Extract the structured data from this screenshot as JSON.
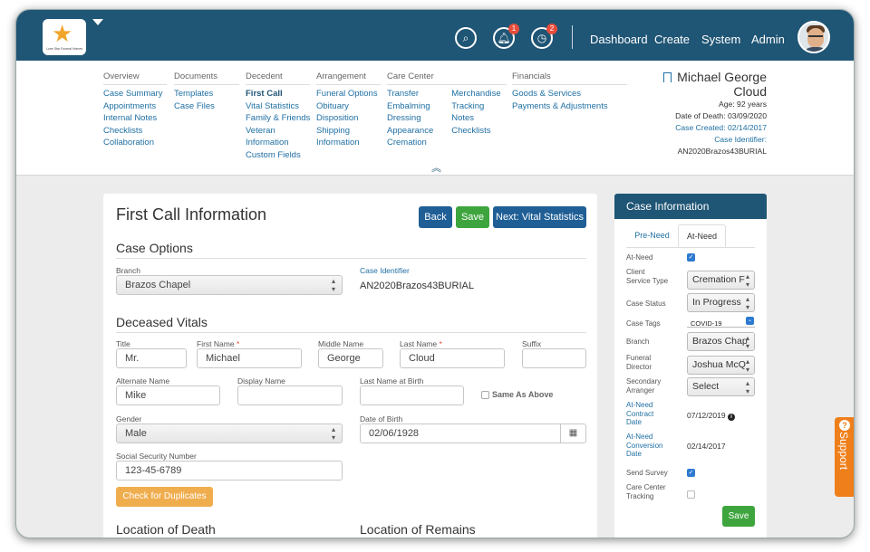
{
  "logo": {
    "text": "Lone Star Funeral Homes"
  },
  "topnav": {
    "notifications_count": "1",
    "alerts_count": "2",
    "items": [
      "Dashboard",
      "Create",
      "System",
      "Admin"
    ]
  },
  "subnav": {
    "overview": {
      "header": "Overview",
      "links": [
        "Case Summary",
        "Appointments",
        "Internal Notes",
        "Checklists",
        "Collaboration"
      ]
    },
    "documents": {
      "header": "Documents",
      "links": [
        "Templates",
        "Case Files"
      ]
    },
    "decedent": {
      "header": "Decedent",
      "links": [
        "First Call",
        "Vital Statistics",
        "Family & Friends",
        "Veteran",
        "Information",
        "Custom Fields"
      ]
    },
    "arrangement": {
      "header": "Arrangement",
      "links": [
        "Funeral Options",
        "Obituary",
        "Disposition",
        "Shipping",
        "Information"
      ]
    },
    "care_center": {
      "header": "Care Center",
      "links_a": [
        "Transfer",
        "Embalming",
        "Dressing",
        "Appearance",
        "Cremation"
      ],
      "links_b": [
        "Merchandise",
        "Tracking",
        "Notes",
        "Checklists"
      ]
    },
    "financials": {
      "header": "Financials",
      "links": [
        "Goods & Services",
        "Payments & Adjustments"
      ]
    }
  },
  "client": {
    "name_line1": "Michael George",
    "name_line2": "Cloud",
    "age": "Age: 92 years",
    "date_of_death": "Date of Death: 03/09/2020",
    "case_created": "Case Created: 02/14/2017",
    "case_identifier_label": "Case Identifier:",
    "case_identifier": "AN2020Brazos43BURIAL"
  },
  "form": {
    "title": "First Call Information",
    "back_label": "Back",
    "save_label": "Save",
    "next_label": "Next: Vital Statistics",
    "case_options_title": "Case Options",
    "branch_label": "Branch",
    "branch_value": "Brazos Chapel",
    "case_identifier_label": "Case Identifier",
    "case_identifier_value": "AN2020Brazos43BURIAL",
    "deceased_vitals_title": "Deceased Vitals",
    "title_label": "Title",
    "title_value": "Mr.",
    "first_name_label": "First Name",
    "first_name_value": "Michael",
    "middle_name_label": "Middle Name",
    "middle_name_value": "George",
    "last_name_label": "Last Name",
    "last_name_value": "Cloud",
    "suffix_label": "Suffix",
    "suffix_value": "",
    "alternate_name_label": "Alternate Name",
    "alternate_name_value": "Mike",
    "display_name_label": "Display Name",
    "display_name_value": "",
    "last_name_birth_label": "Last Name at Birth",
    "last_name_birth_value": "",
    "same_as_above_label": "Same As Above",
    "gender_label": "Gender",
    "gender_value": "Male",
    "dob_label": "Date of Birth",
    "dob_value": "02/06/1928",
    "ssn_label": "Social Security Number",
    "ssn_value": "123-45-6789",
    "check_duplicates_label": "Check for Duplicates",
    "location_death_title": "Location of Death",
    "location_remains_title": "Location of Remains"
  },
  "case_info": {
    "title": "Case Information",
    "tab_preneed": "Pre-Need",
    "tab_atneed": "At-Need",
    "at_need_label": "At-Need",
    "client_service_type_label": "Client Service Type",
    "client_service_type_value": "Cremation F",
    "case_status_label": "Case Status",
    "case_status_value": "In Progress",
    "case_tags_label": "Case Tags",
    "case_tags_value": "COVID-19",
    "branch_label": "Branch",
    "branch_value": "Brazos Chap",
    "funeral_director_label": "Funeral Director",
    "funeral_director_value": "Joshua McQ",
    "secondary_arranger_label": "Secondary Arranger",
    "secondary_arranger_value": "Select",
    "contract_date_label": "At-Need Contract Date",
    "contract_date_value": "07/12/2019",
    "conversion_date_label": "At-Need Conversion Date",
    "conversion_date_value": "02/14/2017",
    "send_survey_label": "Send Survey",
    "care_center_tracking_label": "Care Center Tracking",
    "save_label": "Save"
  },
  "support": {
    "label": "Support"
  },
  "colors": {
    "brand": "#1f5575",
    "link": "#1f6fa3",
    "save": "#3ea53e",
    "action": "#f0ad4e",
    "support": "#ef7f1a"
  }
}
